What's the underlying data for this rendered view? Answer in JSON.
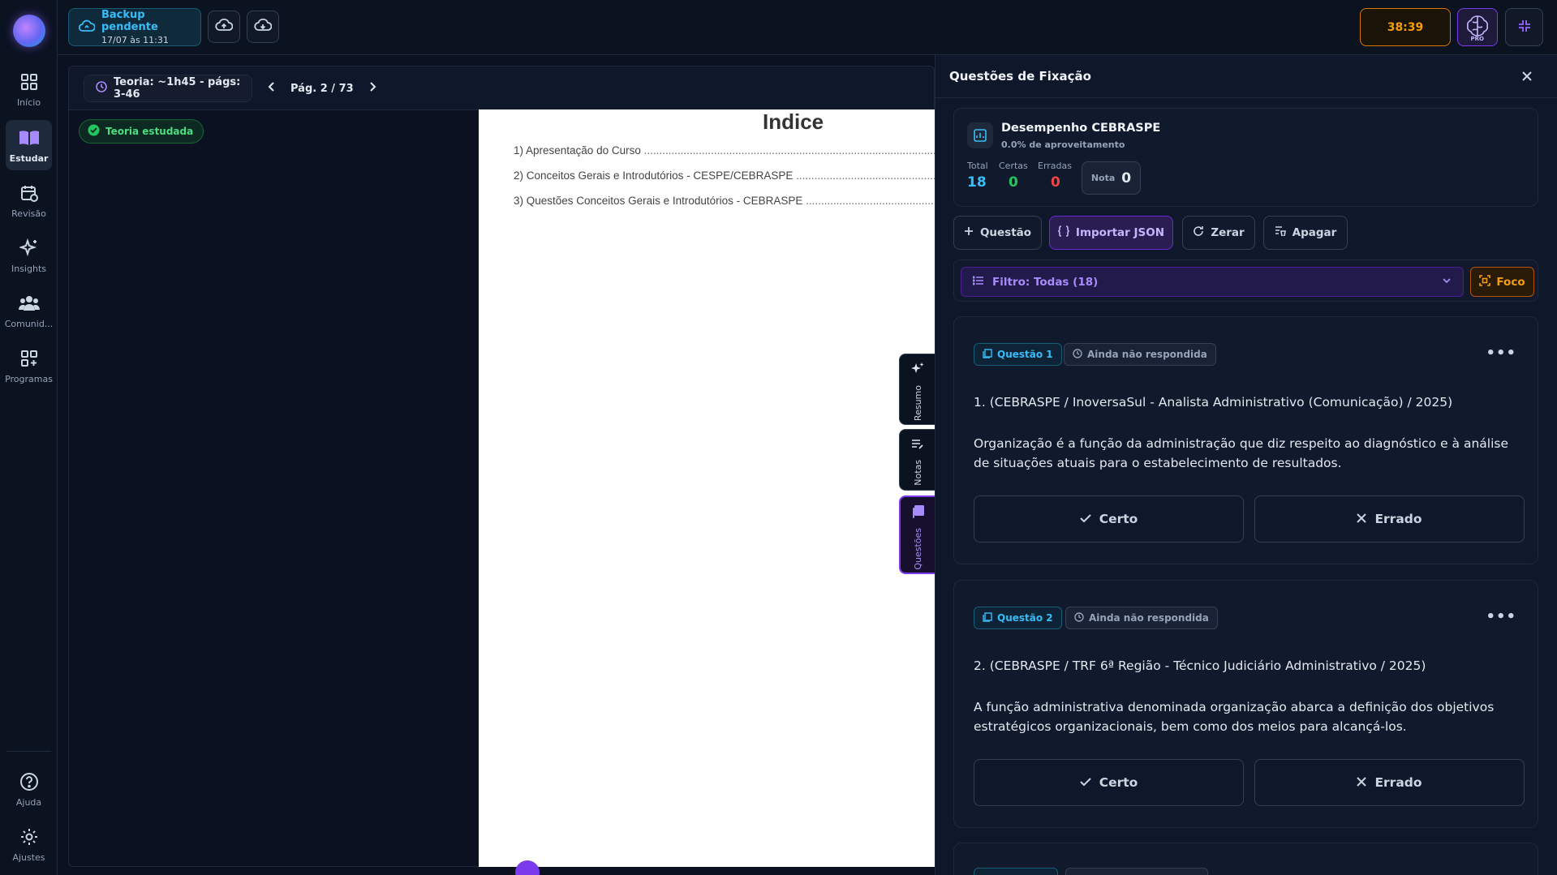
{
  "sidebar": {
    "items": [
      {
        "label": "Início",
        "icon": "grid-icon"
      },
      {
        "label": "Estudar",
        "icon": "book-icon"
      },
      {
        "label": "Revisão",
        "icon": "calendar-sync-icon"
      },
      {
        "label": "Insights",
        "icon": "sparkles-icon"
      },
      {
        "label": "Comunid...",
        "icon": "users-icon"
      },
      {
        "label": "Programas",
        "icon": "grid-plus-icon"
      }
    ],
    "bottom": [
      {
        "label": "Ajuda",
        "icon": "help-circle-icon"
      },
      {
        "label": "Ajustes",
        "icon": "gear-icon"
      }
    ]
  },
  "topbar": {
    "backup_title": "Backup pendente",
    "backup_time": "17/07 às 11:31",
    "timer": "38:39",
    "pro_label": "PRO"
  },
  "reader": {
    "theory_label": "Teoria: ~1h45 - págs: 3-46",
    "page_label": "Pág. 2 / 73",
    "studied_label": "Teoria estudada",
    "pdf": {
      "title": "Indice",
      "lines": [
        "1) Apresentação do Curso",
        "2) Conceitos Gerais e Introdutórios - CESPE/CEBRASPE",
        "3) Questões Conceitos Gerais e Introdutórios - CEBRASPE"
      ]
    },
    "side_tabs": [
      "Resumo",
      "Notas",
      "Questões"
    ]
  },
  "panel": {
    "title": "Questões de Fixação",
    "performance": {
      "title": "Desempenho CEBRASPE",
      "subtitle": "0.0% de aproveitamento",
      "total_label": "Total",
      "total": "18",
      "certas_label": "Certas",
      "certas": "0",
      "erradas_label": "Erradas",
      "erradas": "0",
      "nota_label": "Nota",
      "nota": "0"
    },
    "actions": {
      "questao": "Questão",
      "importar": "Importar JSON",
      "zerar": "Zerar",
      "apagar": "Apagar"
    },
    "filter_label": "Filtro: Todas (18)",
    "foco_label": "Foco",
    "questions": [
      {
        "badge": "Questão 1",
        "status": "Ainda não respondida",
        "header": "1. (CEBRASPE / InoversaSul - Analista Administrativo (Comunicação) / 2025)",
        "body": "Organização é a função da administração que diz respeito ao diagnóstico e à análise de situações atuais para o estabelecimento de resultados.",
        "certo": "Certo",
        "errado": "Errado"
      },
      {
        "badge": "Questão 2",
        "status": "Ainda não respondida",
        "header": "2. (CEBRASPE / TRF 6ª Região - Técnico Judiciário Administrativo / 2025)",
        "body": "A função administrativa denominada organização abarca a definição dos objetivos estratégicos organizacionais, bem como dos meios para alcançá-los.",
        "certo": "Certo",
        "errado": "Errado"
      }
    ]
  },
  "colors": {
    "accent_purple": "#7c3aed",
    "accent_cyan": "#38bdf8",
    "success": "#4ade80",
    "danger": "#ef4444",
    "timer": "#f59e0b"
  }
}
